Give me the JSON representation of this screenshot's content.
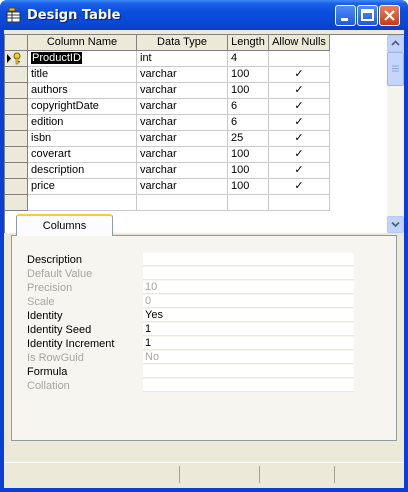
{
  "window": {
    "title": "Design Table",
    "app_icon": "design-table-icon",
    "buttons": [
      "minimize-icon",
      "maximize-icon",
      "close-icon"
    ]
  },
  "grid": {
    "columns": [
      "Column Name",
      "Data Type",
      "Length",
      "Allow Nulls"
    ],
    "rows": [
      {
        "name": "ProductID",
        "type": "int",
        "length": "4",
        "allow_nulls": "",
        "key": true,
        "current": true
      },
      {
        "name": "title",
        "type": "varchar",
        "length": "100",
        "allow_nulls": "✓"
      },
      {
        "name": "authors",
        "type": "varchar",
        "length": "100",
        "allow_nulls": "✓"
      },
      {
        "name": "copyrightDate",
        "type": "varchar",
        "length": "6",
        "allow_nulls": "✓"
      },
      {
        "name": "edition",
        "type": "varchar",
        "length": "6",
        "allow_nulls": "✓"
      },
      {
        "name": "isbn",
        "type": "varchar",
        "length": "25",
        "allow_nulls": "✓"
      },
      {
        "name": "coverart",
        "type": "varchar",
        "length": "100",
        "allow_nulls": "✓"
      },
      {
        "name": "description",
        "type": "varchar",
        "length": "100",
        "allow_nulls": "✓"
      },
      {
        "name": "price",
        "type": "varchar",
        "length": "100",
        "allow_nulls": "✓"
      }
    ]
  },
  "properties": {
    "tab_label": "Columns",
    "items": [
      {
        "label": "Description",
        "value": "",
        "enabled": true
      },
      {
        "label": "Default Value",
        "value": "",
        "enabled": false
      },
      {
        "label": "Precision",
        "value": "10",
        "enabled": false
      },
      {
        "label": "Scale",
        "value": "0",
        "enabled": false
      },
      {
        "label": "Identity",
        "value": "Yes",
        "enabled": true
      },
      {
        "label": "Identity Seed",
        "value": "1",
        "enabled": true
      },
      {
        "label": "Identity Increment",
        "value": "1",
        "enabled": true
      },
      {
        "label": "Is RowGuid",
        "value": "No",
        "enabled": false
      },
      {
        "label": "Formula",
        "value": "",
        "enabled": true
      },
      {
        "label": "Collation",
        "value": "",
        "enabled": false
      }
    ]
  },
  "colors": {
    "titlebar": "#0a4ede",
    "client": "#ece9d8",
    "tab_accent": "#ffc83c"
  }
}
